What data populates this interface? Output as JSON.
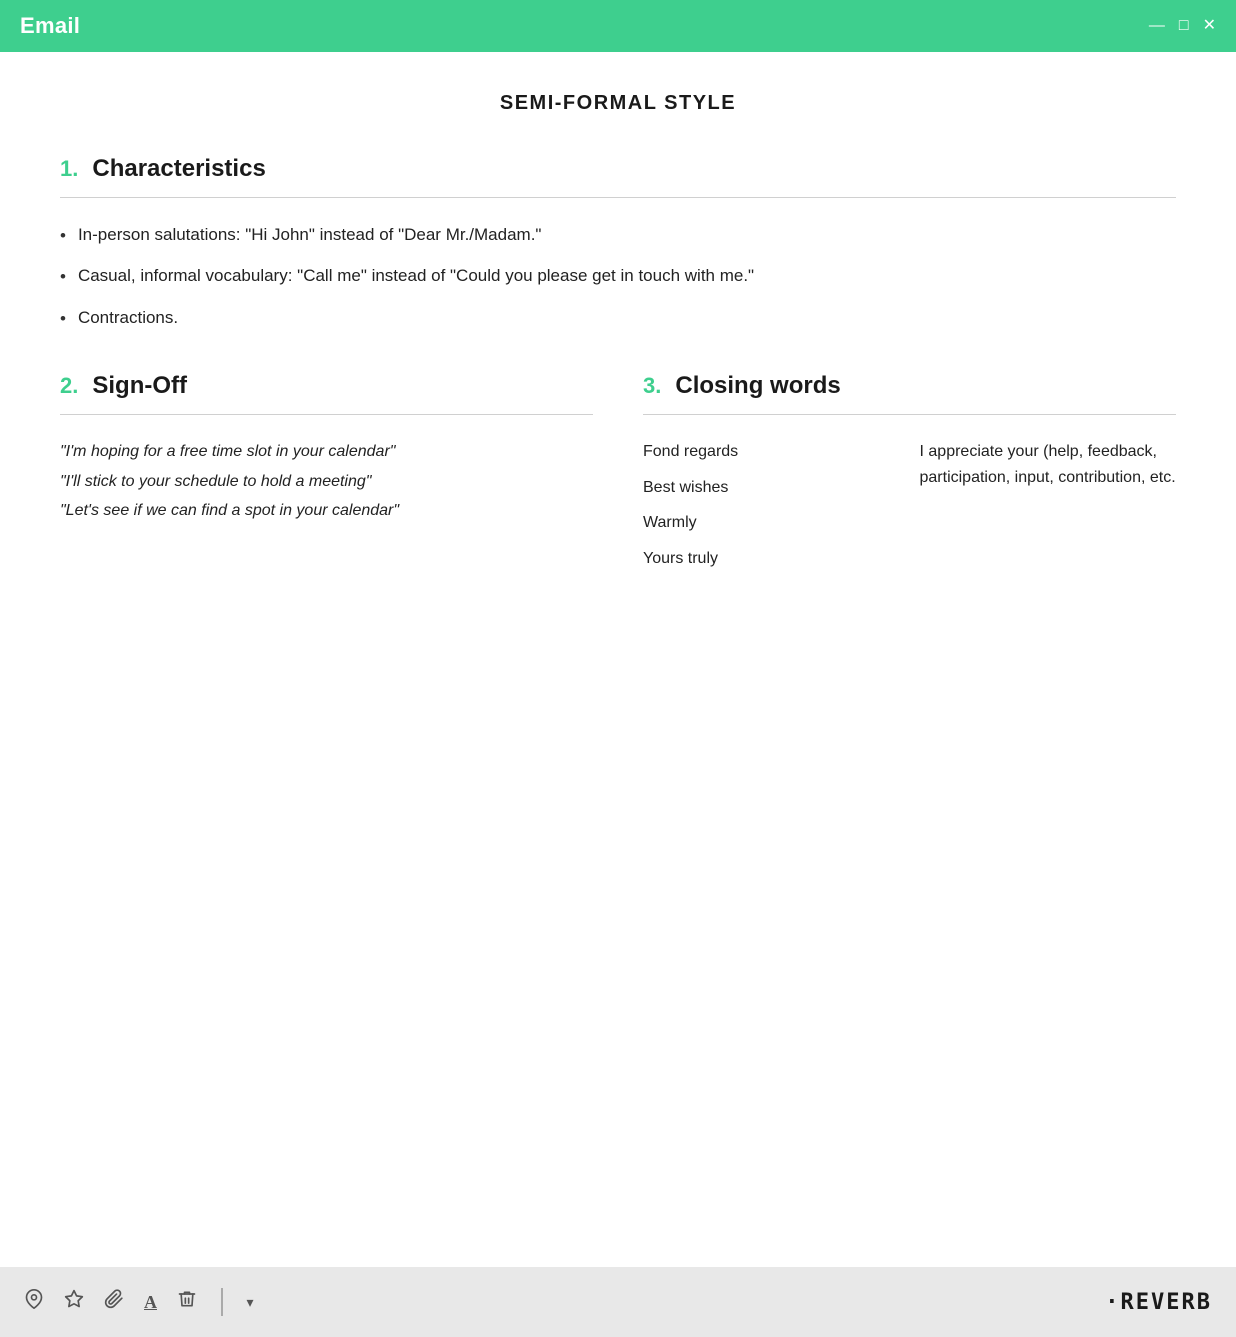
{
  "titlebar": {
    "title": "Email",
    "controls": [
      "—",
      "□",
      "✕"
    ]
  },
  "page": {
    "main_title": "SEMI-FORMAL STYLE",
    "section1": {
      "number": "1.",
      "title": "Characteristics",
      "bullets": [
        "In-person salutations: \"Hi John\" instead of \"Dear Mr./Madam.\"",
        "Casual, informal vocabulary: \"Call me\" instead of \"Could you please get in touch with me.\"",
        "Contractions."
      ]
    },
    "section2": {
      "number": "2.",
      "title": "Sign-Off",
      "quotes": [
        "\"I'm hoping for a free time slot in your calendar\"",
        "\"I'll stick to your schedule to hold a meeting\"",
        "\"Let's see if we can find a spot in your calendar\""
      ]
    },
    "section3": {
      "number": "3.",
      "title": "Closing words",
      "words": [
        "Fond regards",
        "Best wishes",
        "Warmly",
        "Yours truly"
      ],
      "description": "I appreciate your (help, feedback, participation, input, contribution, etc."
    }
  },
  "footer": {
    "icons": [
      "📍",
      "☆",
      "🖇",
      "A",
      "🗑"
    ],
    "dropdown_label": "▾",
    "logo": "·REVERB"
  }
}
